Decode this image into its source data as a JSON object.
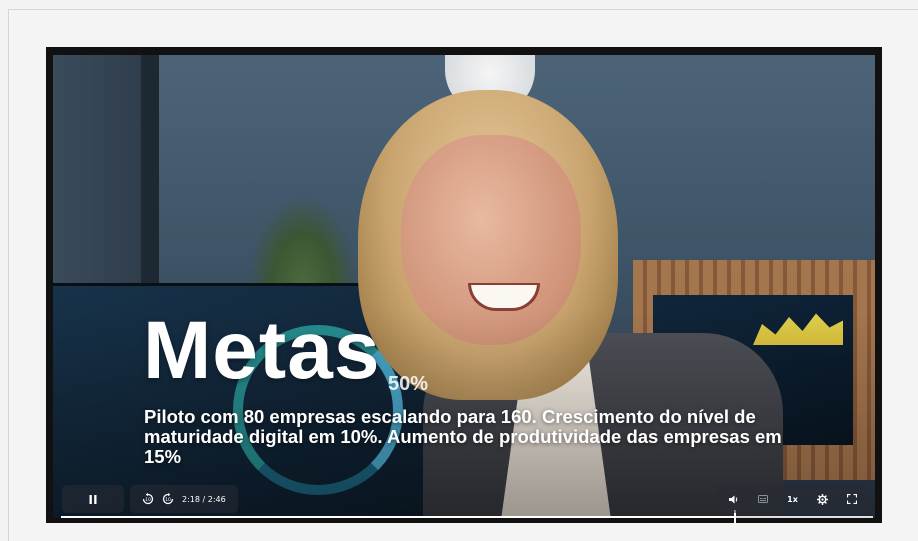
{
  "video": {
    "headline": "Metas",
    "subtitle": "Piloto com 80 empresas escalando para 160. Crescimento do nível de maturidade digital em 10%. Aumento de produtividade das empresas em 15%",
    "overlay_text": "50%"
  },
  "controls": {
    "play_pause_icon": "pause-icon",
    "rewind_icon": "rewind-10-icon",
    "forward_icon": "forward-10-icon",
    "current_time": "2:18",
    "duration": "2:46",
    "time_separator": " / ",
    "progress_fraction": 0.83,
    "volume_icon": "volume-icon",
    "captions_icon": "captions-icon",
    "speed_label": "1x",
    "settings_icon": "gear-icon",
    "fullscreen_icon": "fullscreen-icon"
  },
  "colors": {
    "page_background": "#f3f3f3",
    "player_border": "#111111",
    "control_background": "#282c34",
    "text": "#ffffff"
  }
}
